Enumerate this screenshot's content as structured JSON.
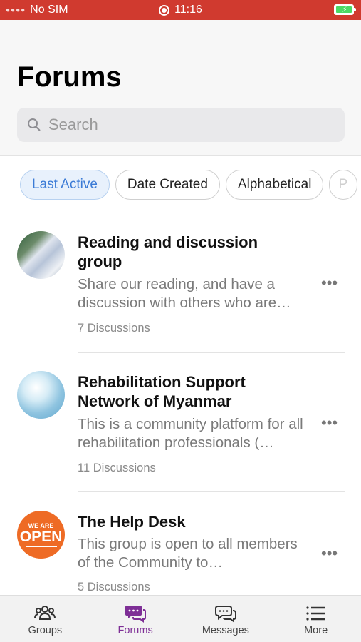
{
  "status_bar": {
    "carrier": "No SIM",
    "time": "11:16"
  },
  "header": {
    "title": "Forums",
    "search_placeholder": "Search"
  },
  "filters": [
    "Last Active",
    "Date Created",
    "Alphabetical",
    "P"
  ],
  "forums": [
    {
      "title": "Reading and discussion group",
      "description": "Share our reading, and have a discussion with others who are…",
      "count": "7 Discussions"
    },
    {
      "title": "Rehabilitation Support Network of Myanmar",
      "description": "This is a community platform for all rehabilitation professionals (…",
      "count": "11 Discussions"
    },
    {
      "title": "The Help Desk",
      "description": "This group is open to all members of the Community to…",
      "count": "5 Discussions",
      "avatar_text_top": "WE ARE",
      "avatar_text_main": "OPEN"
    }
  ],
  "tabs": [
    {
      "label": "Groups",
      "icon": "groups-icon"
    },
    {
      "label": "Forums",
      "icon": "forums-icon",
      "active": true
    },
    {
      "label": "Messages",
      "icon": "messages-icon"
    },
    {
      "label": "More",
      "icon": "more-icon"
    }
  ],
  "colors": {
    "status_bar": "#d03a2f",
    "accent": "#7e2f96",
    "chip_active": "#3b7bd6"
  }
}
